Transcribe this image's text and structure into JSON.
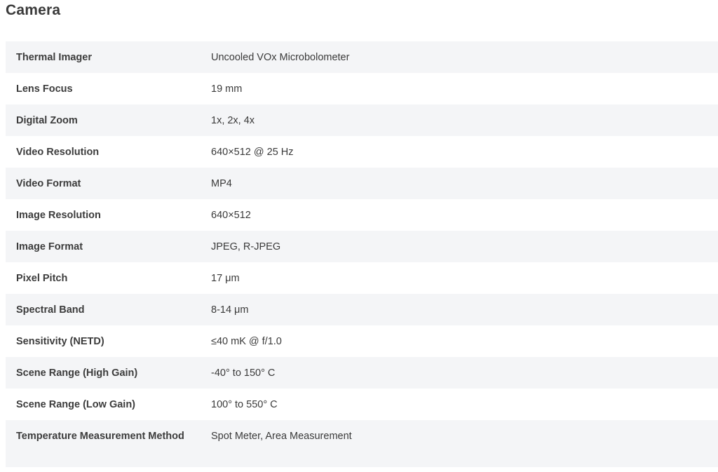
{
  "section": {
    "title": "Camera"
  },
  "specs": [
    {
      "label": "Thermal Imager",
      "value": "Uncooled VOx Microbolometer"
    },
    {
      "label": "Lens Focus",
      "value": "19 mm"
    },
    {
      "label": "Digital Zoom",
      "value": "1x, 2x, 4x"
    },
    {
      "label": "Video Resolution",
      "value": "640×512 @ 25 Hz"
    },
    {
      "label": "Video Format",
      "value": "MP4"
    },
    {
      "label": "Image Resolution",
      "value": "640×512"
    },
    {
      "label": "Image Format",
      "value": "JPEG, R-JPEG"
    },
    {
      "label": "Pixel Pitch",
      "value": "17 μm"
    },
    {
      "label": "Spectral Band",
      "value": "8-14 μm"
    },
    {
      "label": "Sensitivity (NETD)",
      "value": "≤40 mK @ f/1.0"
    },
    {
      "label": "Scene Range (High Gain)",
      "value": "-40° to 150° C"
    },
    {
      "label": "Scene Range (Low Gain)",
      "value": "100° to 550° C"
    },
    {
      "label": "Temperature Measurement Method",
      "value": "Spot Meter, Area Measurement"
    }
  ]
}
